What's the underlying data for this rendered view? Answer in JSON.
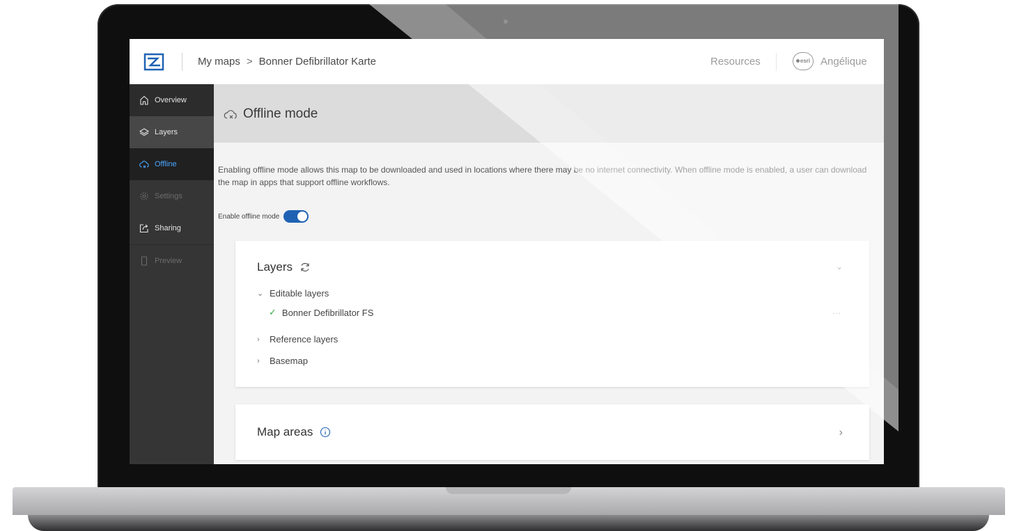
{
  "header": {
    "breadcrumb_root": "My maps",
    "breadcrumb_sep": ">",
    "breadcrumb_current": "Bonner Defibrillator Karte",
    "resources_label": "Resources",
    "avatar_text": "esri",
    "user_name": "Angélique"
  },
  "sidebar": {
    "items": [
      {
        "label": "Overview",
        "icon": "home-icon"
      },
      {
        "label": "Layers",
        "icon": "layers-icon"
      },
      {
        "label": "Offline",
        "icon": "cloud-offline-icon",
        "active": true
      },
      {
        "label": "Settings",
        "icon": "gear-icon",
        "disabled": true
      },
      {
        "label": "Sharing",
        "icon": "share-icon"
      },
      {
        "label": "Preview",
        "icon": "mobile-icon",
        "disabled": true
      }
    ]
  },
  "main": {
    "title": "Offline mode",
    "description": "Enabling offline mode allows this map to be downloaded and used in locations where there may be no internet connectivity. When offline mode is enabled, a user can download the map in apps that support offline workflows.",
    "toggle_label": "Enable offline mode",
    "toggle_on": true,
    "layers_card": {
      "title": "Layers",
      "editable_label": "Editable layers",
      "editable_items": [
        "Bonner Defibrillator FS"
      ],
      "more_label": "...",
      "reference_label": "Reference layers",
      "basemap_label": "Basemap"
    },
    "areas_card": {
      "title": "Map areas"
    }
  },
  "colors": {
    "accent": "#1f62b4",
    "active_nav": "#4aa8ff",
    "check": "#35ac46",
    "sidebar_bg": "#353535"
  }
}
